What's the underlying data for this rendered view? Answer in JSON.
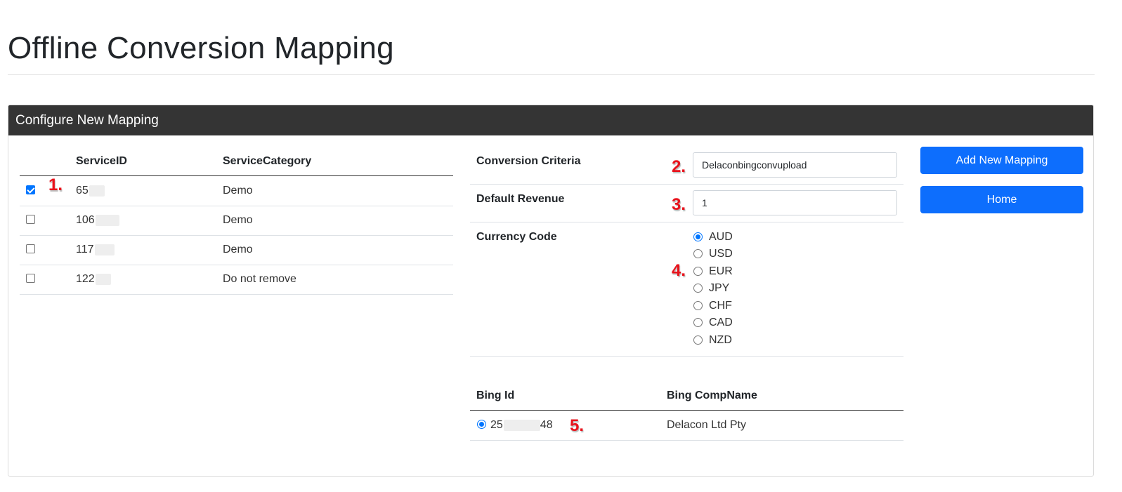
{
  "page": {
    "title": "Offline Conversion Mapping"
  },
  "card": {
    "header": "Configure New Mapping"
  },
  "services": {
    "headers": [
      "ServiceID",
      "ServiceCategory"
    ],
    "rows": [
      {
        "id": "65",
        "category": "Demo",
        "checked": true
      },
      {
        "id": "106",
        "category": "Demo",
        "checked": false
      },
      {
        "id": "117",
        "category": "Demo",
        "checked": false
      },
      {
        "id": "122",
        "category": "Do not remove",
        "checked": false
      }
    ]
  },
  "form": {
    "conversion_criteria_label": "Conversion Criteria",
    "conversion_criteria_value": "Delaconbingconvupload",
    "default_revenue_label": "Default Revenue",
    "default_revenue_value": "1",
    "currency_code_label": "Currency Code",
    "currencies": [
      "AUD",
      "USD",
      "EUR",
      "JPY",
      "CHF",
      "CAD",
      "NZD"
    ],
    "selected_currency": "AUD"
  },
  "bing": {
    "headers": [
      "Bing Id",
      "Bing CompName"
    ],
    "rows": [
      {
        "id_start": "25",
        "id_end": "48",
        "comp_name": "Delacon Ltd Pty",
        "selected": true
      }
    ]
  },
  "buttons": {
    "add_new_mapping": "Add New Mapping",
    "home": "Home"
  },
  "annotations": [
    "1.",
    "2.",
    "3.",
    "4.",
    "5."
  ],
  "colors": {
    "header_bg": "#343434",
    "button_bg": "#0d6efd",
    "annotation": "#e8131c",
    "radio_selected": "#0075ff"
  }
}
